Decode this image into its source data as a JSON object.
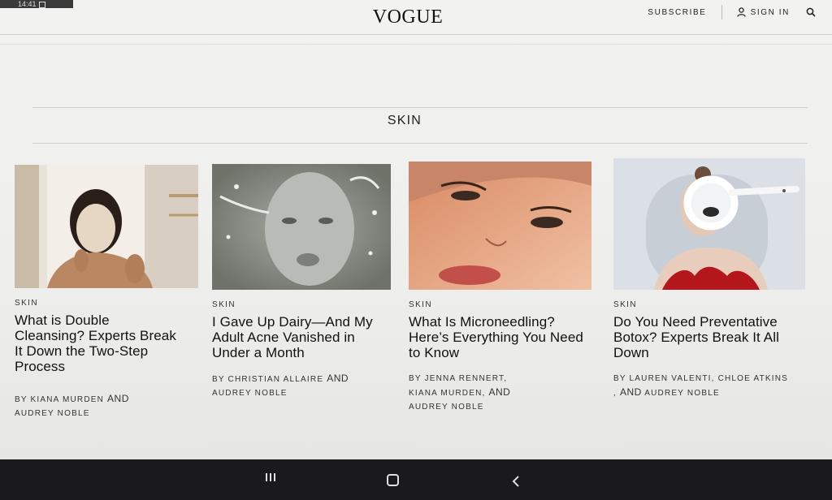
{
  "status_bar": {
    "time": "14:41"
  },
  "header": {
    "logo": "VOGUE",
    "subscribe_label": "SUBSCRIBE",
    "sign_in_label": "SIGN IN"
  },
  "section": {
    "title": "SKIN"
  },
  "cards": [
    {
      "category": "SKIN",
      "title": "What is Double Cleansing? Experts Break It Down the Two-Step Process",
      "byline": [
        "BY KIANA MURDEN",
        "AND",
        "AUDREY NOBLE"
      ]
    },
    {
      "category": "SKIN",
      "title": "I Gave Up Dairy—And My Adult Acne Vanished in Under a Month",
      "byline": [
        "BY CHRISTIAN ALLAIRE",
        "AND",
        "AUDREY NOBLE"
      ]
    },
    {
      "category": "SKIN",
      "title": "What Is Microneedling? Here’s Everything You Need to Know",
      "byline": [
        "BY JENNA RENNERT,",
        "KIANA MURDEN,",
        "AND",
        "AUDREY NOBLE"
      ]
    },
    {
      "category": "SKIN",
      "title": "Do You Need Preventative Botox? Experts Break It All Down",
      "byline": [
        "BY LAUREN VALENTI, CHLOE ATKINS",
        ",",
        "AND",
        "AUDREY NOBLE"
      ]
    }
  ],
  "icons": {
    "user": "user-icon",
    "search": "search-icon",
    "recent_apps": "recent-apps-icon",
    "home": "home-icon",
    "back": "back-icon"
  },
  "colors": {
    "page_background": "#efefed",
    "text": "#111111",
    "system_bar": "#1a1a1c"
  }
}
